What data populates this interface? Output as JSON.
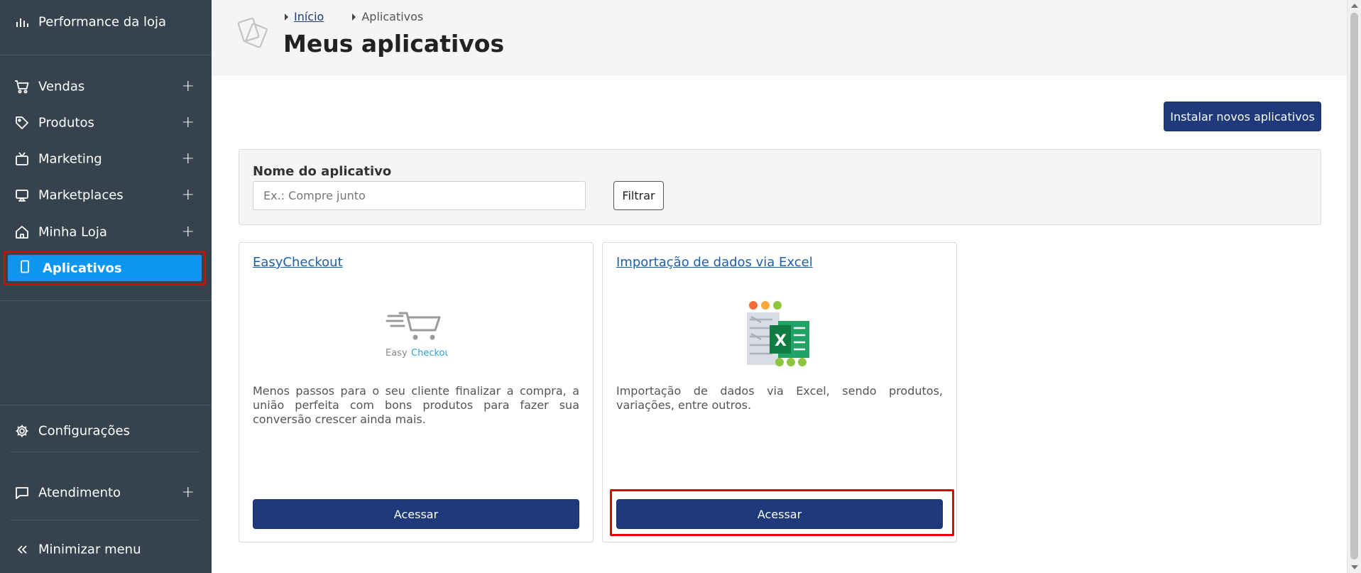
{
  "sidebar": {
    "top_item": {
      "label": "Performance da loja",
      "icon": "bar-chart-icon"
    },
    "items": [
      {
        "label": "Vendas",
        "icon": "cart-icon",
        "expand": "+"
      },
      {
        "label": "Produtos",
        "icon": "tag-icon",
        "expand": "+"
      },
      {
        "label": "Marketing",
        "icon": "tv-icon",
        "expand": "+"
      },
      {
        "label": "Marketplaces",
        "icon": "monitor-icon",
        "expand": "+"
      },
      {
        "label": "Minha Loja",
        "icon": "home-icon",
        "expand": "+"
      }
    ],
    "active_item": {
      "label": "Aplicativos",
      "icon": "phone-icon"
    },
    "settings": {
      "label": "Configurações",
      "icon": "gear-icon"
    },
    "support": {
      "label": "Atendimento",
      "icon": "chat-icon",
      "expand": "+"
    },
    "minimize": {
      "label": "Minimizar menu",
      "icon": "double-chevron-left-icon"
    }
  },
  "header": {
    "breadcrumb": [
      {
        "label": "Início",
        "link": true
      },
      {
        "label": "Aplicativos",
        "link": false
      }
    ],
    "title": "Meus aplicativos"
  },
  "toolbar": {
    "install_label": "Instalar novos aplicativos"
  },
  "filter": {
    "label": "Nome do aplicativo",
    "placeholder": "Ex.: Compre junto",
    "value": "",
    "button_label": "Filtrar"
  },
  "apps": [
    {
      "title": "EasyCheckout",
      "logo_text_1": "Easy",
      "logo_text_2": "Checkout",
      "description": "Menos passos para o seu cliente finalizar a compra, a união perfeita com bons produtos para fazer sua conversão crescer ainda mais.",
      "button_label": "Acessar"
    },
    {
      "title": "Importação de dados via Excel",
      "logo_text": "X",
      "description": "Importação de dados via Excel, sendo produtos, variações, entre outros.",
      "button_label": "Acessar"
    }
  ],
  "colors": {
    "sidebar_bg": "#37424f",
    "active_bg": "#0d95f0",
    "primary_button": "#1e3a7b",
    "link": "#1f5ea8",
    "highlight": "#e00000"
  }
}
